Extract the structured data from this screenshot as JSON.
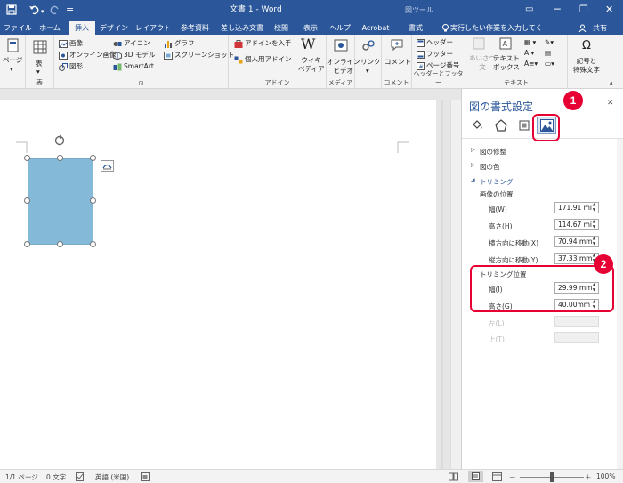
{
  "title": {
    "doc_title": "文書 1 - Word",
    "tool_context": "図ツール",
    "minimize_glyph": "─",
    "restore_glyph": "❐",
    "close_glyph": "✕",
    "ribbon_display_glyph": "▭"
  },
  "qat": {
    "save_icon": "save-icon",
    "undo_icon": "undo-icon",
    "redo_icon": "redo-icon",
    "customize_glyph": "="
  },
  "tabs": [
    {
      "label": "ファイル"
    },
    {
      "label": "ホーム"
    },
    {
      "label": "挿入"
    },
    {
      "label": "デザイン"
    },
    {
      "label": "レイアウト"
    },
    {
      "label": "参考資料"
    },
    {
      "label": "差し込み文書"
    },
    {
      "label": "校閲"
    },
    {
      "label": "表示"
    },
    {
      "label": "ヘルプ"
    },
    {
      "label": "Acrobat"
    },
    {
      "label": "書式"
    }
  ],
  "tell_me": "実行したい作業を入力してください",
  "share": "共有",
  "ribbon": {
    "pages": "ページ",
    "table": "表",
    "table_group": "表",
    "picture": "画像",
    "online_picture": "オンライン画像",
    "shapes": "図形",
    "icons": "アイコン",
    "model3d": "3D モデル",
    "smartart": "SmartArt",
    "chart": "グラフ",
    "screenshot": "スクリーンショット",
    "illust_group_glyph": "⊡",
    "get_addins": "アドインを入手",
    "my_addins": "個人用アドイン",
    "wiki_glyph": "W",
    "wikipedia": "ウィキ\nペディア",
    "addins_group": "アドイン",
    "online_video": "オンライン\nビデオ",
    "media_group": "メディア",
    "link": "リンク",
    "comment": "コメント",
    "comment_group": "コメント",
    "header": "ヘッダー",
    "footer": "フッター",
    "page_number": "ページ番号",
    "hf_group": "ヘッダーとフッター",
    "greeting": "あいさつ\n文",
    "textbox": "テキスト\nボックス",
    "text_group": "テキスト",
    "symbols": "記号と\n特殊文字",
    "symbol_glyph": "Ω"
  },
  "pane": {
    "title": "図の書式設定",
    "close_glyph": "✕",
    "sections": [
      {
        "label": "図の修整",
        "expanded": false
      },
      {
        "label": "図の色",
        "expanded": false
      },
      {
        "label": "トリミング",
        "expanded": true
      }
    ],
    "image_position": "画像の位置",
    "fields": [
      {
        "label": "幅(W)",
        "value": "171.91 mi"
      },
      {
        "label": "高さ(H)",
        "value": "114.67 mi"
      },
      {
        "label": "横方向に移動(X)",
        "value": "70.94 mm"
      },
      {
        "label": "縦方向に移動(Y)",
        "value": "37.33 mm"
      }
    ],
    "crop_position": "トリミング位置",
    "crop_fields": [
      {
        "label": "幅(I)",
        "value": "29.99 mm"
      },
      {
        "label": "高さ(G)",
        "value": "40.00mm"
      },
      {
        "label": "左(L)",
        "value": ""
      },
      {
        "label": "上(T)",
        "value": ""
      }
    ]
  },
  "badges": {
    "one": "1",
    "two": "2"
  },
  "status": {
    "page": "1/1 ページ",
    "words": "0 文字",
    "language": "英語 (米国)",
    "zoom": "100%",
    "zoom_level": 1.0,
    "minus": "－",
    "plus": "＋"
  },
  "colors": {
    "brand": "#2b579a",
    "accent_red": "#e60033",
    "image_fill": "#85b9d8"
  }
}
